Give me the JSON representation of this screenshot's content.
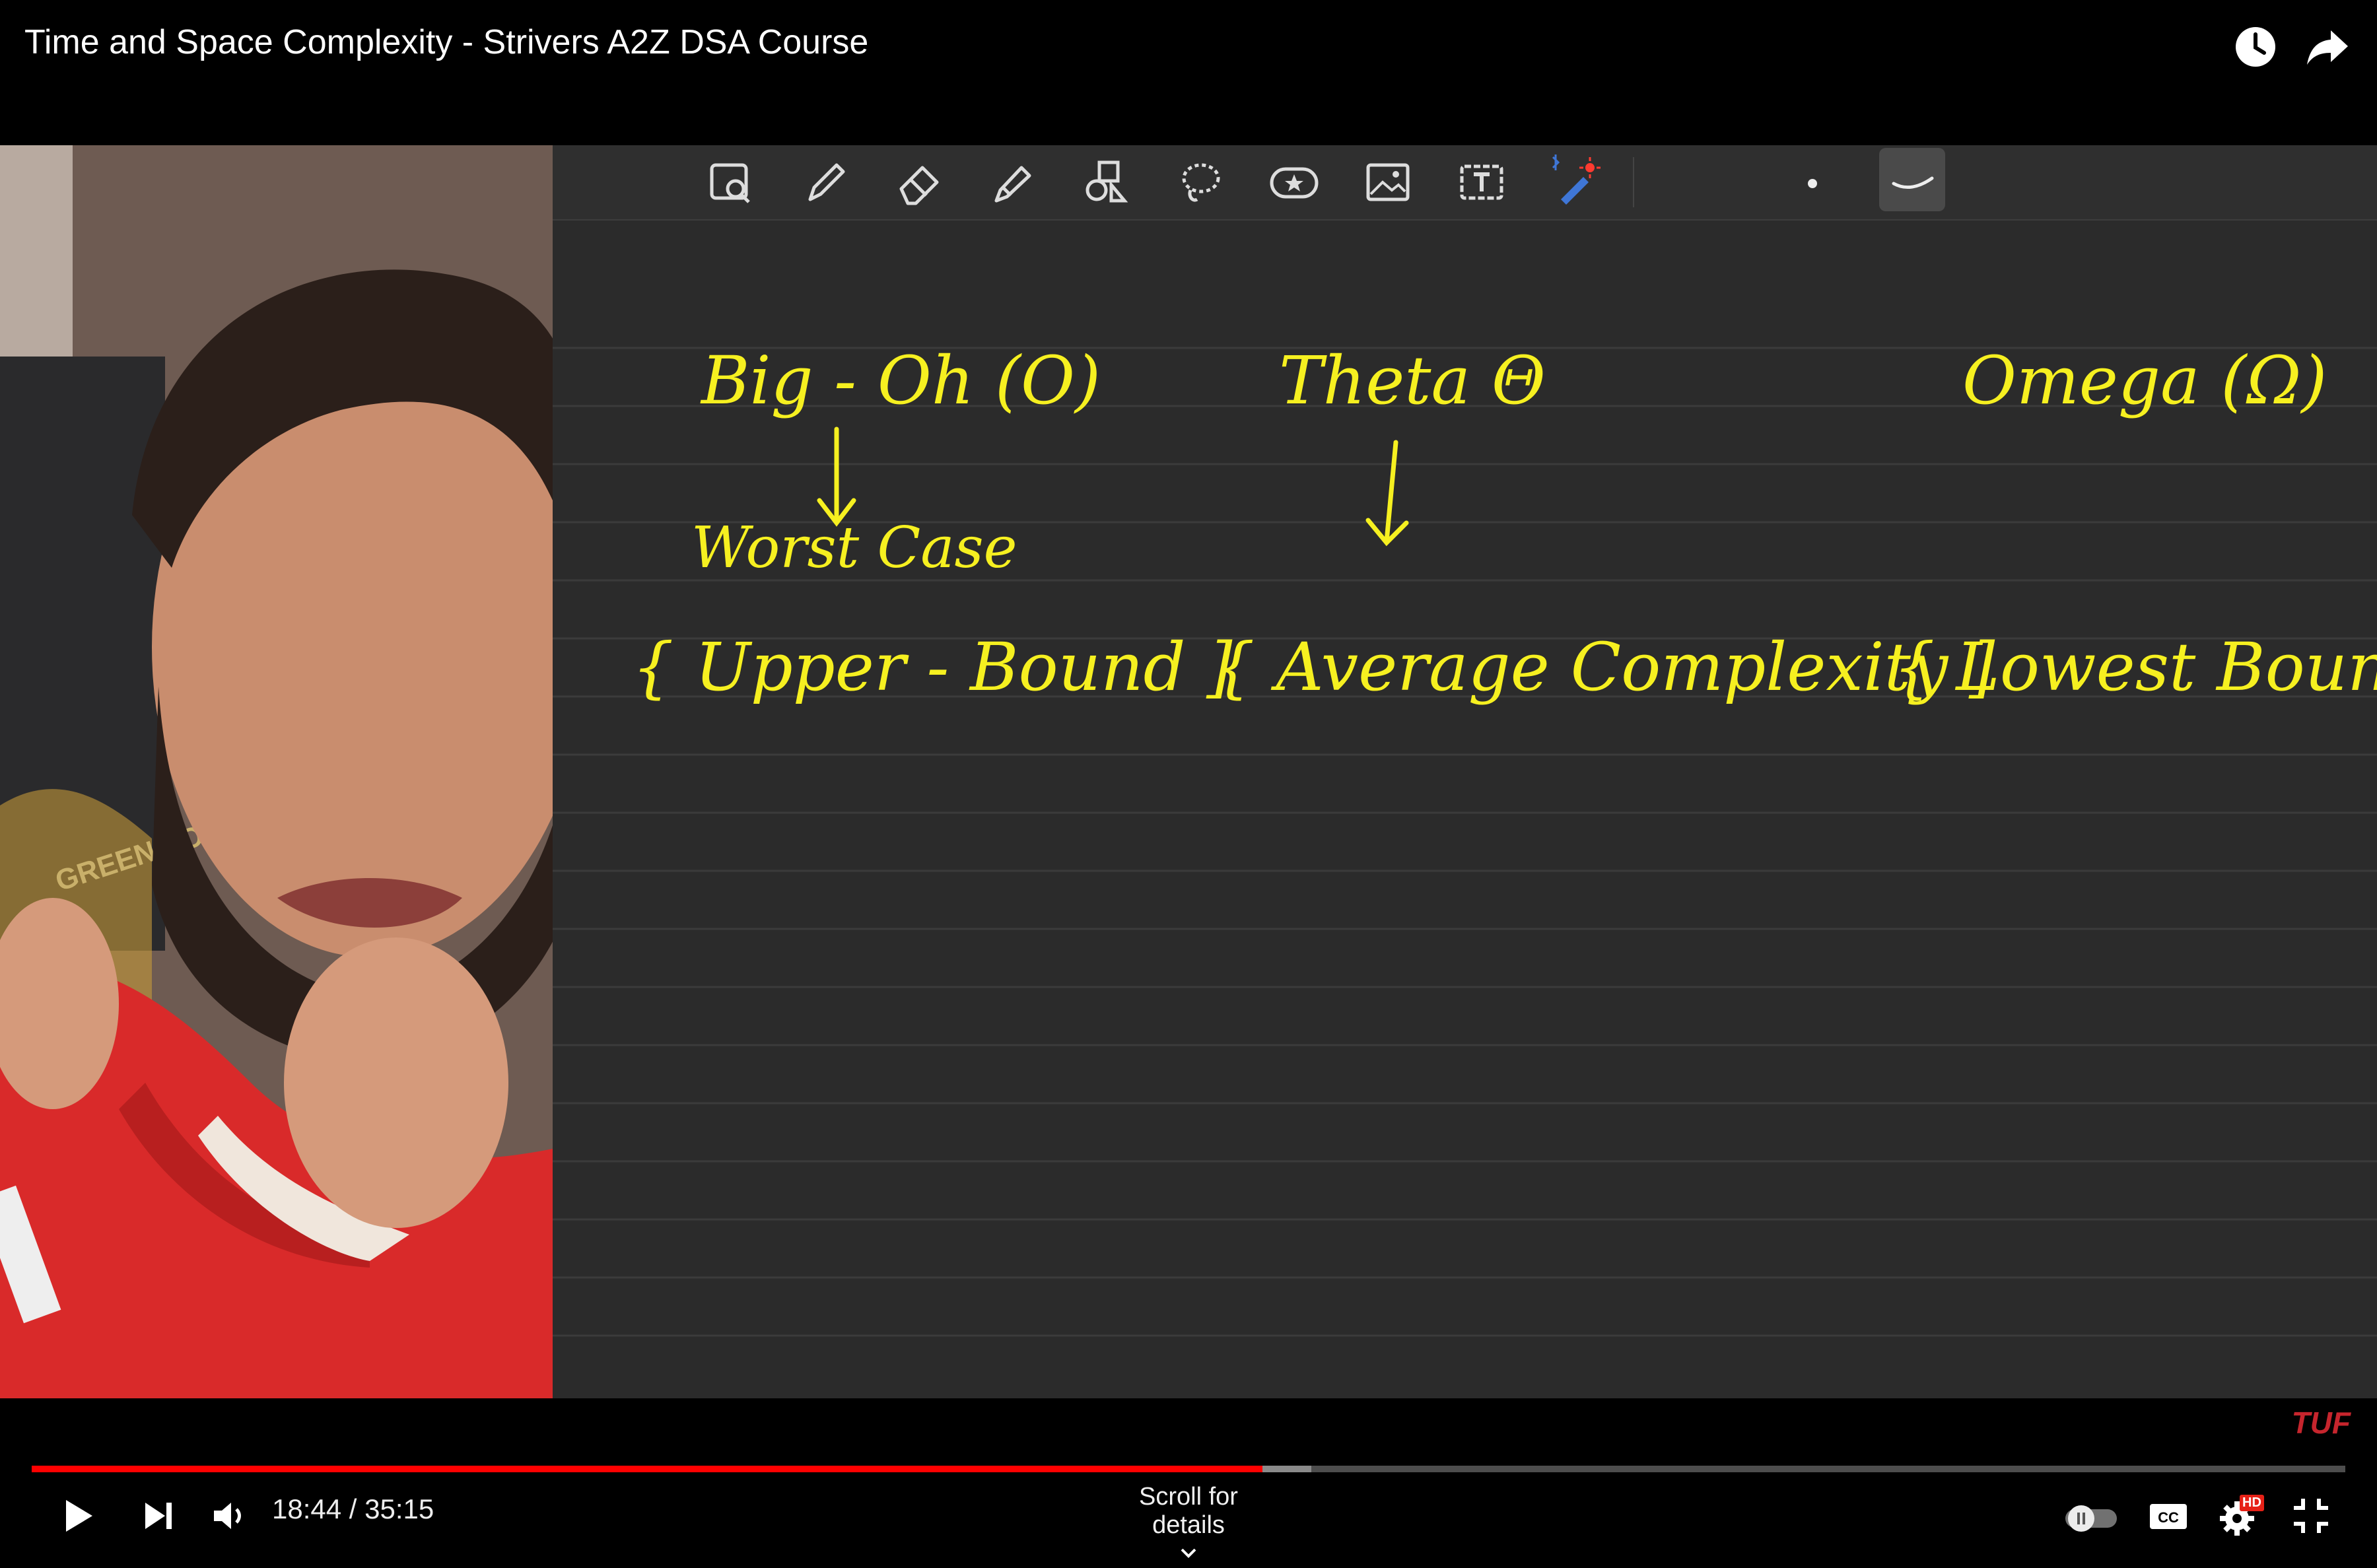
{
  "video": {
    "title": "Time and Space Complexity - Strivers A2Z DSA Course"
  },
  "top_icons": [
    "watch-later-icon",
    "share-icon"
  ],
  "toolbar": {
    "tools": [
      "zoom-icon",
      "pen-icon",
      "eraser-icon",
      "highlighter-icon",
      "shapes-icon",
      "lasso-icon",
      "sticker-icon",
      "image-icon",
      "text-box-icon",
      "laser-pointer-icon"
    ]
  },
  "board": {
    "notations": [
      {
        "title": "Big - Oh (O)",
        "case": "Worst Case",
        "bound": "{ Upper - Bound ]"
      },
      {
        "title": "Theta Θ",
        "case": "",
        "bound": "{ Average Complexity ]"
      },
      {
        "title": "Omega (Ω)",
        "case": "",
        "bound": "{ Lowest Bound ]"
      }
    ]
  },
  "watermark": "TUF",
  "player": {
    "current_time": "18:44",
    "duration": "35:15",
    "time_display": "18:44 / 35:15",
    "progress_fraction": 0.532,
    "buffered_fraction": 0.553,
    "scroll_hint": "Scroll for details",
    "quality_badge": "HD",
    "colors": {
      "progress": "#ff0000",
      "ink": "#f6f020",
      "watermark": "#c6252d"
    }
  },
  "presenter": {
    "hoodie_text": "GREEN SOUL"
  }
}
